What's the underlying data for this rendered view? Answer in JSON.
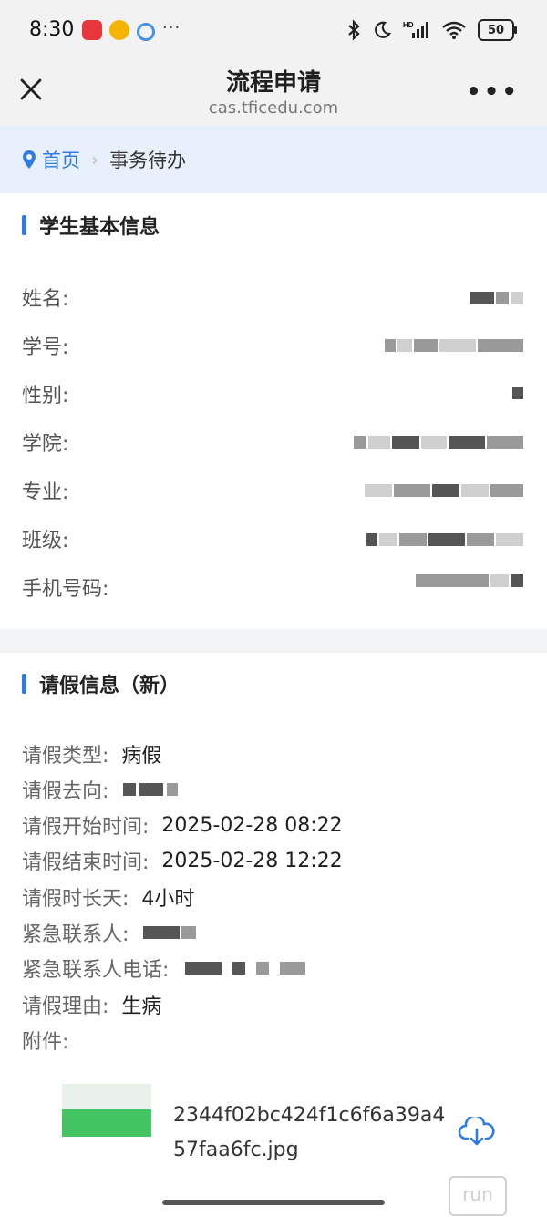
{
  "status_bar": {
    "time": "8:30",
    "more_dots": "···",
    "battery": "50",
    "icons": [
      "bluetooth-icon",
      "moon-icon",
      "hd-signal-icon",
      "wifi-icon",
      "battery-icon"
    ]
  },
  "nav": {
    "title": "流程申请",
    "url": "cas.tficedu.com"
  },
  "breadcrumb": {
    "home": "首页",
    "current": "事务待办"
  },
  "student_section": {
    "title": "学生基本信息",
    "fields": [
      {
        "label": "姓名:"
      },
      {
        "label": "学号:"
      },
      {
        "label": "性别:"
      },
      {
        "label": "学院:"
      },
      {
        "label": "专业:"
      },
      {
        "label": "班级:"
      },
      {
        "label": "手机号码:"
      }
    ]
  },
  "leave_section": {
    "title": "请假信息（新）",
    "fields": [
      {
        "label": "请假类型:",
        "value": "病假"
      },
      {
        "label": "请假去向:",
        "value": ""
      },
      {
        "label": "请假开始时间:",
        "value": "2025-02-28 08:22"
      },
      {
        "label": "请假结束时间:",
        "value": "2025-02-28 12:22"
      },
      {
        "label": "请假时长天:",
        "value": "4小时"
      },
      {
        "label": "紧急联系人:",
        "value": ""
      },
      {
        "label": "紧急联系人电话:",
        "value": ""
      },
      {
        "label": "请假理由:",
        "value": "生病"
      },
      {
        "label": "附件:",
        "value": ""
      }
    ],
    "attachment": {
      "filename": "2344f02bc424f1c6f6a39a457faa6fc.jpg"
    }
  },
  "colors": {
    "accent": "#2f7be0",
    "breadcrumb_bg": "#e8f0fb",
    "header_bg": "#f2f2f2"
  }
}
